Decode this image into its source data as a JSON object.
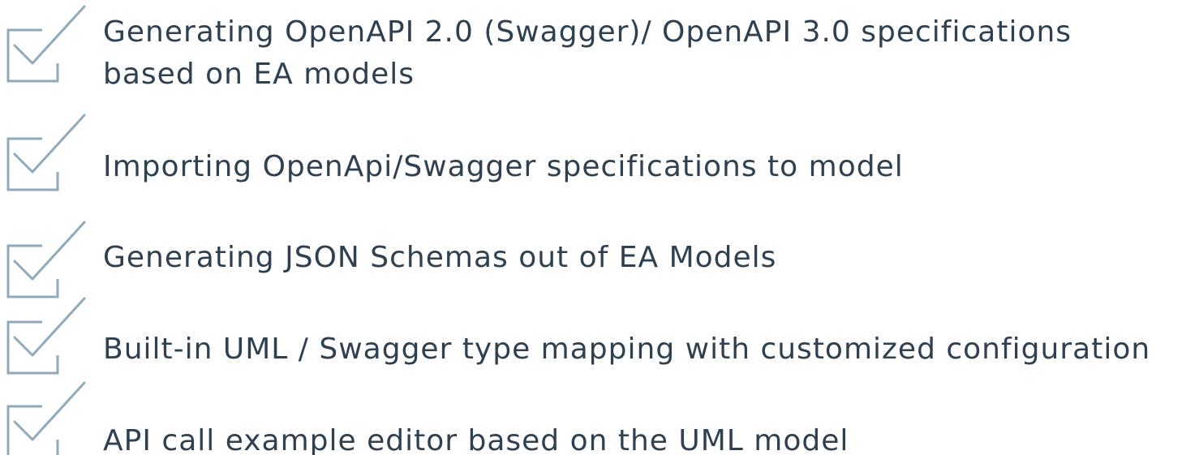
{
  "accent_color": "#8faabd",
  "text_color": "#2f4151",
  "features": [
    {
      "icon": "checkbox-check-icon",
      "lines": [
        "Generating OpenAPI 2.0 (Swagger)/ OpenAPI 3.0 specifications",
        "based on EA models"
      ]
    },
    {
      "icon": "checkbox-check-icon",
      "lines": [
        "Importing OpenApi/Swagger specifications to model"
      ]
    },
    {
      "icon": "checkbox-check-icon",
      "lines": [
        "Generating  JSON Schemas out of EA Models"
      ]
    },
    {
      "icon": "checkbox-check-icon",
      "lines": [
        "Built-in UML / Swagger type mapping with customized configuration"
      ]
    },
    {
      "icon": "checkbox-check-icon",
      "lines": [
        "API call example editor based on the UML model"
      ]
    }
  ]
}
